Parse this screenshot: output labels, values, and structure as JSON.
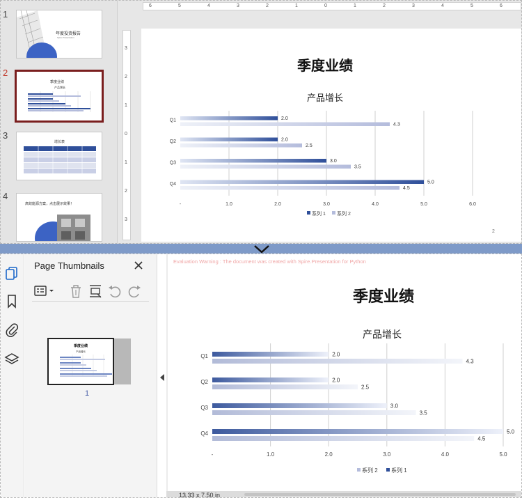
{
  "slides": [
    {
      "number": "1",
      "title": "年度投资报告",
      "subtitle": "Spire.Presentation"
    },
    {
      "number": "2",
      "title": "季度业绩",
      "subtitle": "产品增长"
    },
    {
      "number": "3",
      "title": "增长表"
    },
    {
      "number": "4",
      "title": "高效能源方案，点击展示效果！"
    }
  ],
  "active_slide": "2",
  "slide_page_number": "2",
  "vertical_ruler_labels": [
    "3",
    "2",
    "1",
    "0",
    "1",
    "2",
    "3"
  ],
  "horizontal_ruler_labels": [
    "6",
    "5",
    "4",
    "3",
    "2",
    "1",
    "0",
    "1",
    "2",
    "3",
    "4",
    "5",
    "6"
  ],
  "pdf_viewer": {
    "panel_title": "Page Thumbnails",
    "thumbnail_page_number": "1",
    "warning": "Evaluation Warning : The document was created with Spire.Presentation for Python",
    "page_size": "13.33 x 7.50 in"
  },
  "colors": {
    "series1": "#2f4f9a",
    "series2": "#b4bcdc",
    "active_thumb_border": "#7a1e1e",
    "separator": "#7e9ac8"
  },
  "chart_data": [
    {
      "type": "bar",
      "orientation": "horizontal",
      "title": "季度业绩",
      "subtitle": "产品增长",
      "categories": [
        "Q1",
        "Q2",
        "Q3",
        "Q4"
      ],
      "series": [
        {
          "name": "系列 1",
          "values": [
            2.0,
            2.0,
            3.0,
            5.0
          ]
        },
        {
          "name": "系列 2",
          "values": [
            4.3,
            2.5,
            3.5,
            4.5
          ]
        }
      ],
      "xticks": [
        "-",
        "1.0",
        "2.0",
        "3.0",
        "4.0",
        "5.0",
        "6.0"
      ],
      "xlim": [
        0,
        6
      ],
      "grid": true,
      "legend": "bottom",
      "legend_entries": [
        "系列 1",
        "系列 2"
      ],
      "data_labels": [
        [
          "2.0",
          "2.0",
          "3.0",
          "5.0"
        ],
        [
          "4.3",
          "2.5",
          "3.5",
          "4.5"
        ]
      ]
    },
    {
      "type": "bar",
      "orientation": "horizontal",
      "title": "季度业绩",
      "subtitle": "产品增长",
      "categories": [
        "Q1",
        "Q2",
        "Q3",
        "Q4"
      ],
      "series": [
        {
          "name": "系列 1",
          "values": [
            2.0,
            2.0,
            3.0,
            5.0
          ]
        },
        {
          "name": "系列 2",
          "values": [
            4.3,
            2.5,
            3.5,
            4.5
          ]
        }
      ],
      "xticks": [
        "-",
        "1.0",
        "2.0",
        "3.0",
        "4.0",
        "5.0"
      ],
      "xlim": [
        0,
        5
      ],
      "grid": true,
      "legend": "bottom",
      "legend_entries": [
        "系列 2",
        "系列 1"
      ],
      "data_labels": [
        [
          "2.0",
          "2.0",
          "3.0",
          "5.0"
        ],
        [
          "4.3",
          "2.5",
          "3.5",
          "4.5"
        ]
      ]
    }
  ]
}
